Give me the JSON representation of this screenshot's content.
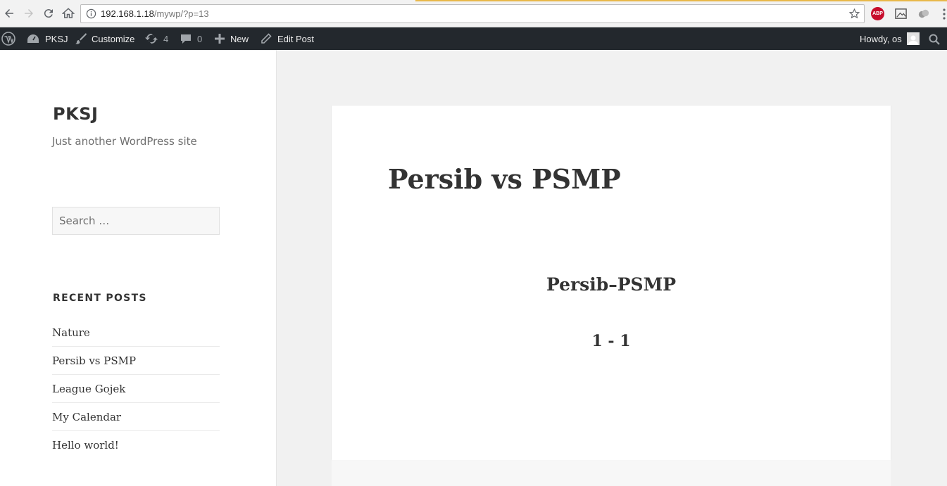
{
  "browser": {
    "url_host": "192.168.1.18",
    "url_path": "/mywp/?p=13",
    "abp_label": "ABP",
    "icons": [
      "back-icon",
      "forward-icon",
      "reload-icon",
      "home-icon",
      "info-icon",
      "star-icon",
      "menu-icon"
    ]
  },
  "adminbar": {
    "site_name": "PKSJ",
    "customize": "Customize",
    "updates_count": "4",
    "comments_count": "0",
    "new_label": "New",
    "edit_post": "Edit Post",
    "howdy": "Howdy, os"
  },
  "sidebar": {
    "site_title": "PKSJ",
    "site_description": "Just another WordPress site",
    "search_placeholder": "Search …",
    "recent_posts_title": "RECENT POSTS",
    "recent_posts": [
      "Nature",
      "Persib vs PSMP",
      "League Gojek",
      "My Calendar",
      "Hello world!"
    ]
  },
  "post": {
    "title": "Persib vs PSMP",
    "subtitle": "Persib–PSMP",
    "score": "1 - 1"
  },
  "colors": {
    "adminbar_bg": "#23282d",
    "text_dark": "#333333",
    "page_bg": "#f1f1f1"
  }
}
